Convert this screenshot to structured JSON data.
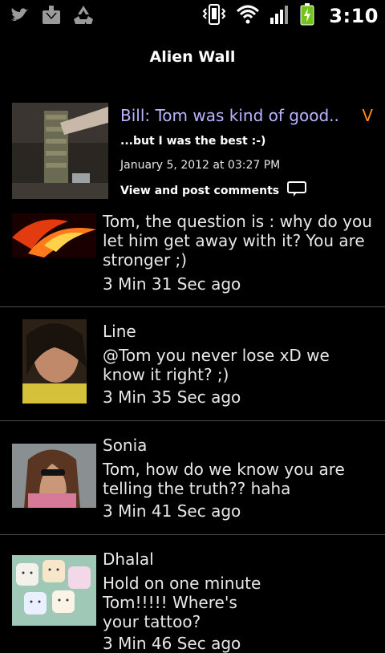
{
  "status": {
    "left_icons": [
      "twitter-icon",
      "download-icon",
      "recycle-icon"
    ],
    "right_icons": [
      "vibrate-icon",
      "wifi-icon",
      "signal-icon",
      "battery-charging-icon"
    ],
    "time": "3:10"
  },
  "header": {
    "title": "Alien Wall"
  },
  "post": {
    "title": "Bill: Tom was kind of good..",
    "marker": "V",
    "subtitle": "...but I was the best :-)",
    "date": "January 5, 2012 at 03:27 PM",
    "comments_label": "View and post comments"
  },
  "comments": [
    {
      "name": "",
      "text": "Tom, the question is : why do you let him get away with it? You are stronger ;)",
      "time": "3 Min 31 Sec ago"
    },
    {
      "name": "Line",
      "text": "@Tom you never lose xD we know it right? ;)",
      "time": "3 Min 35 Sec ago"
    },
    {
      "name": "Sonia",
      "text": "Tom, how do we know you are telling the truth?? haha",
      "time": "3 Min 41 Sec ago"
    },
    {
      "name": "Dhalal",
      "text": "Hold on one minute Tom!!!!! Where's your tattoo?",
      "time": "3 Min 46 Sec ago"
    }
  ],
  "colors": {
    "post_title": "#b9b4ff",
    "marker": "#ff8a1a",
    "divider": "#4a4a4a"
  }
}
